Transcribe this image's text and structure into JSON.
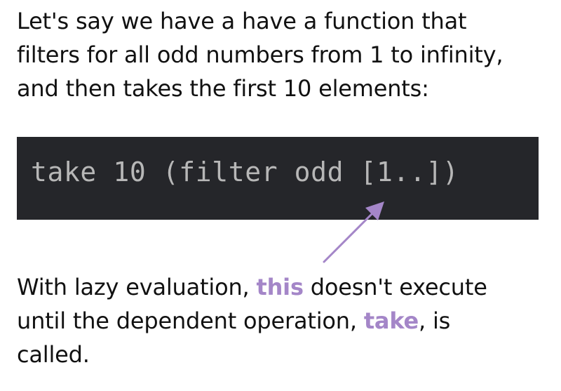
{
  "intro": {
    "line1": "Let's say we have a have a function that",
    "line2": "filters for all odd numbers from 1 to infinity,",
    "line3": "and then takes the first 10 elements:"
  },
  "code": {
    "text": "take 10 (filter odd [1..])"
  },
  "note": {
    "line1_pre": "With lazy evaluation, ",
    "line1_highlight": "this",
    "line1_post": " doesn't execute",
    "line2_pre": "until the dependent operation, ",
    "line2_highlight": "take",
    "line2_post": ", is",
    "line3": "called."
  },
  "colors": {
    "code_background": "#25262a",
    "code_text": "#b7b7b7",
    "highlight": "#a486c8",
    "arrow": "#a486c8"
  },
  "icons": {
    "arrow": "arrow-up-right-icon"
  }
}
